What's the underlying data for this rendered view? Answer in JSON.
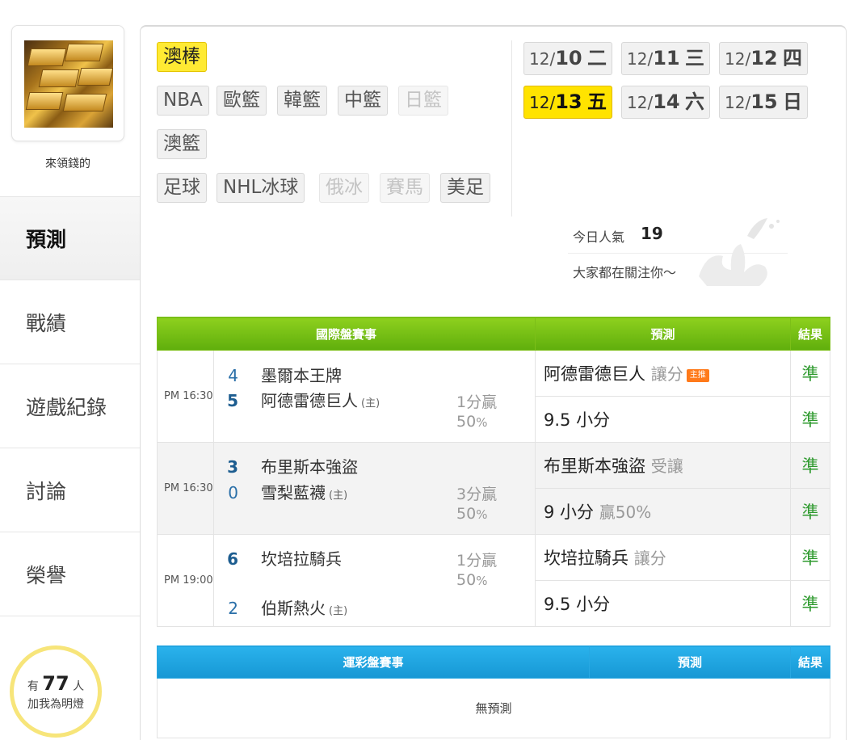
{
  "sidebar": {
    "username": "來領錢的",
    "nav": [
      "預測",
      "戰績",
      "遊戲紀錄",
      "討論",
      "榮譽"
    ],
    "fans": {
      "prefix": "有",
      "count": "77",
      "suffix": "人",
      "line2": "加我為明燈"
    }
  },
  "categories": {
    "row1": [
      "澳棒"
    ],
    "row2": [
      "NBA",
      "歐籃",
      "韓籃",
      "中籃",
      "日籃"
    ],
    "row3": [
      "澳籃"
    ],
    "row4": [
      "足球",
      "NHL冰球",
      "俄冰",
      "賽馬",
      "美足"
    ],
    "active": "澳棒",
    "disabled": [
      "日籃",
      "俄冰",
      "賽馬"
    ]
  },
  "dates": [
    {
      "md": "12/",
      "day": "10",
      "wd": "二"
    },
    {
      "md": "12/",
      "day": "11",
      "wd": "三"
    },
    {
      "md": "12/",
      "day": "12",
      "wd": "四"
    },
    {
      "md": "12/",
      "day": "13",
      "wd": "五"
    },
    {
      "md": "12/",
      "day": "14",
      "wd": "六"
    },
    {
      "md": "12/",
      "day": "15",
      "wd": "日"
    }
  ],
  "popularity": {
    "label": "今日人氣",
    "count": "19",
    "message": "大家都在關注你～"
  },
  "intl_table": {
    "headers": [
      "國際盤賽事",
      "預測",
      "結果"
    ],
    "games": [
      {
        "time": "PM 16:30",
        "away": {
          "score": "4",
          "name": "墨爾本王牌"
        },
        "home": {
          "score": "5",
          "name": "阿德雷德巨人",
          "home_mark": "(主)"
        },
        "spread": "1分贏",
        "pct": "50",
        "pct_unit": "%",
        "picks": [
          {
            "text": "阿德雷德巨人",
            "note": "讓分",
            "tag": "主推",
            "result": "準"
          },
          {
            "text": "9.5 小分",
            "note": "",
            "tag": "",
            "result": "準"
          }
        ]
      },
      {
        "time": "PM 16:30",
        "away": {
          "score": "3",
          "name": "布里斯本強盜"
        },
        "home": {
          "score": "0",
          "name": "雪梨藍襪",
          "home_mark": "(主)"
        },
        "spread": "3分贏",
        "pct": "50",
        "pct_unit": "%",
        "picks": [
          {
            "text": "布里斯本強盜",
            "note": "受讓",
            "tag": "",
            "result": "準"
          },
          {
            "text": "9 小分",
            "note": "贏50%",
            "tag": "",
            "result": "準"
          }
        ]
      },
      {
        "time": "PM 19:00",
        "away": {
          "score": "6",
          "name": "坎培拉騎兵"
        },
        "home": {
          "score": "2",
          "name": "伯斯熱火",
          "home_mark": "(主)"
        },
        "spread": "1分贏",
        "pct": "50",
        "pct_unit": "%",
        "picks": [
          {
            "text": "坎培拉騎兵",
            "note": "讓分",
            "tag": "",
            "result": "準"
          },
          {
            "text": "9.5 小分",
            "note": "",
            "tag": "",
            "result": "準"
          }
        ]
      }
    ]
  },
  "lottery_table": {
    "headers": [
      "運彩盤賽事",
      "預測",
      "結果"
    ],
    "empty": "無預測"
  },
  "colors": {
    "accent_yellow": "#ffe300",
    "green_header": "#6cbd12",
    "blue_header": "#1fa5e0",
    "result_green": "#2e9a2e"
  }
}
